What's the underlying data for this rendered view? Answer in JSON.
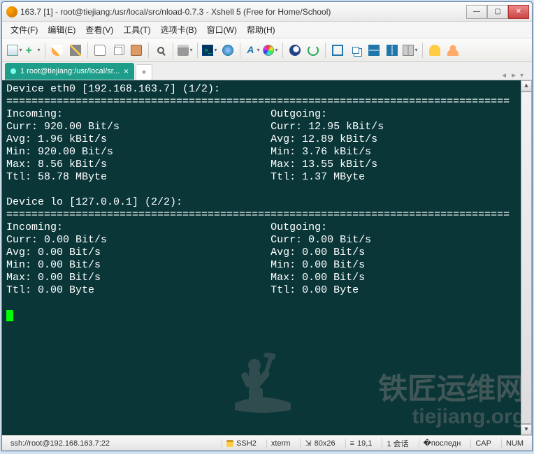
{
  "window": {
    "title": "163.7 [1]  - root@tiejiang:/usr/local/src/nload-0.7.3 - Xshell 5 (Free for Home/School)"
  },
  "menu": {
    "file": "文件(F)",
    "edit": "编辑(E)",
    "view": "查看(V)",
    "tools": "工具(T)",
    "tabs": "选项卡(B)",
    "window": "窗口(W)",
    "help": "帮助(H)"
  },
  "tab": {
    "label": "1 root@tiejiang:/usr/local/sr..."
  },
  "terminal": {
    "dev1_header": "Device eth0 [192.168.163.7] (1/2):",
    "sep": "================================================================================",
    "incoming_label": "Incoming:",
    "outgoing_label": "Outgoing:",
    "d1_in_curr": "Curr: 920.00 Bit/s",
    "d1_out_curr": "Curr: 12.95 kBit/s",
    "d1_in_avg": "Avg: 1.96 kBit/s",
    "d1_out_avg": "Avg: 12.89 kBit/s",
    "d1_in_min": "Min: 920.00 Bit/s",
    "d1_out_min": "Min: 3.76 kBit/s",
    "d1_in_max": "Max: 8.56 kBit/s",
    "d1_out_max": "Max: 13.55 kBit/s",
    "d1_in_ttl": "Ttl: 58.78 MByte",
    "d1_out_ttl": "Ttl: 1.37 MByte",
    "dev2_header": "Device lo [127.0.0.1] (2/2):",
    "d2_in_curr": "Curr: 0.00 Bit/s",
    "d2_out_curr": "Curr: 0.00 Bit/s",
    "d2_in_avg": "Avg: 0.00 Bit/s",
    "d2_out_avg": "Avg: 0.00 Bit/s",
    "d2_in_min": "Min: 0.00 Bit/s",
    "d2_out_min": "Min: 0.00 Bit/s",
    "d2_in_max": "Max: 0.00 Bit/s",
    "d2_out_max": "Max: 0.00 Bit/s",
    "d2_in_ttl": "Ttl: 0.00 Byte",
    "d2_out_ttl": "Ttl: 0.00 Byte"
  },
  "watermark": {
    "line1": "铁匠运维网",
    "line2": "tiejiang.org"
  },
  "status": {
    "conn": "ssh://root@192.168.163.7:22",
    "proto": "SSH2",
    "term": "xterm",
    "size": "80x26",
    "cursor": "19,1",
    "sessions": "1 会话",
    "cap": "CAP",
    "num": "NUM"
  }
}
